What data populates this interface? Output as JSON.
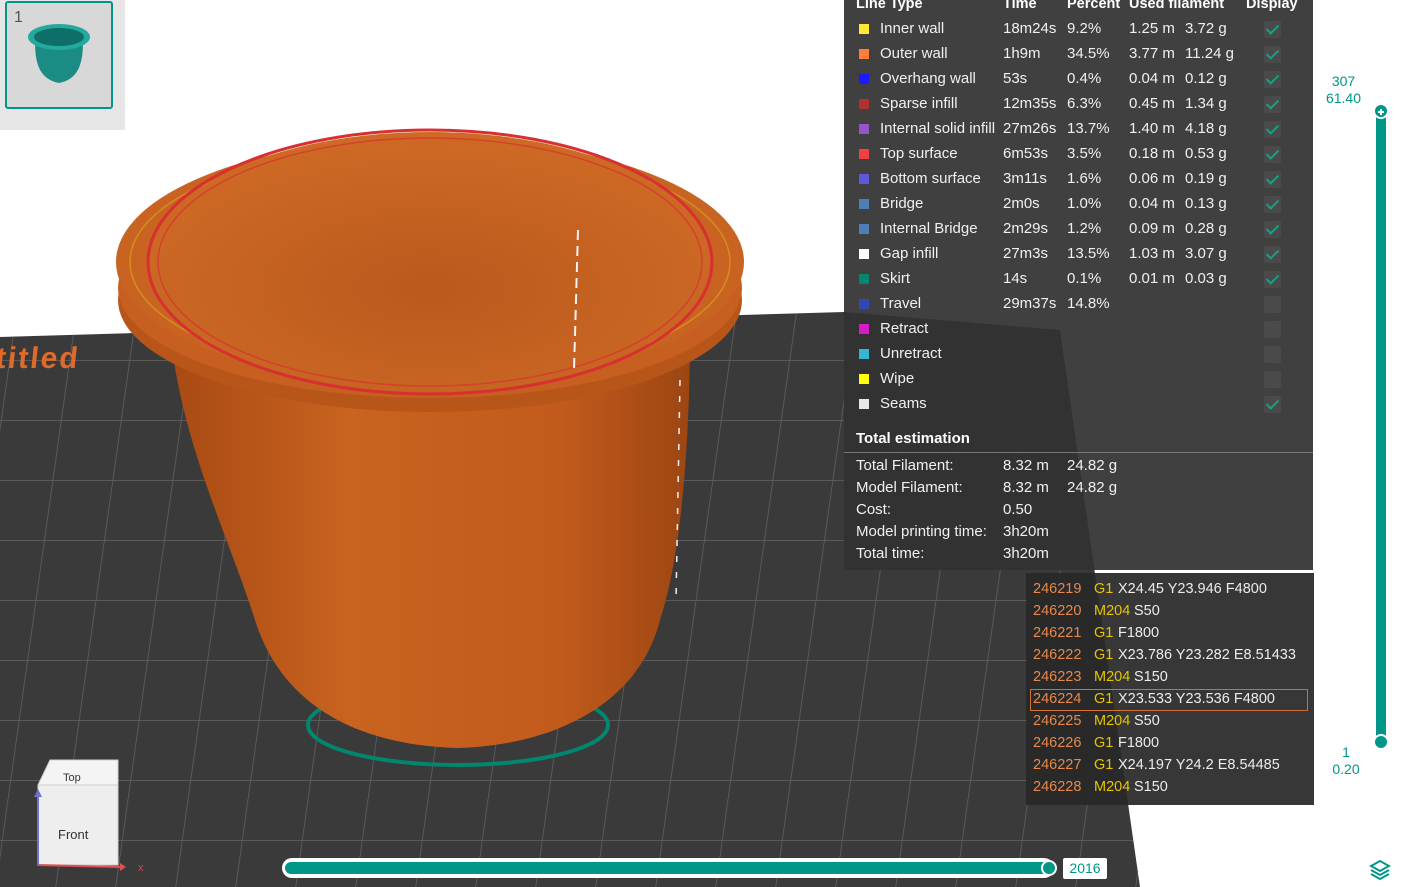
{
  "thumbnail": {
    "index": "1"
  },
  "bed": {
    "label": "titled"
  },
  "legend": {
    "headers": {
      "line_type": "Line Type",
      "time": "Time",
      "percent": "Percent",
      "used": "Used filament",
      "display": "Display"
    },
    "rows": [
      {
        "name": "Inner wall",
        "color": "#FFE733",
        "time": "18m24s",
        "percent": "9.2%",
        "length": "1.25 m",
        "weight": "3.72 g",
        "display": true
      },
      {
        "name": "Outer wall",
        "color": "#FF7D38",
        "time": "1h9m",
        "percent": "34.5%",
        "length": "3.77 m",
        "weight": "11.24 g",
        "display": true
      },
      {
        "name": "Overhang wall",
        "color": "#1A19FF",
        "time": "53s",
        "percent": "0.4%",
        "length": "0.04 m",
        "weight": "0.12 g",
        "display": true
      },
      {
        "name": "Sparse infill",
        "color": "#B0302E",
        "time": "12m35s",
        "percent": "6.3%",
        "length": "0.45 m",
        "weight": "1.34 g",
        "display": true
      },
      {
        "name": "Internal solid infill",
        "color": "#9654CC",
        "time": "27m26s",
        "percent": "13.7%",
        "length": "1.40 m",
        "weight": "4.18 g",
        "display": true
      },
      {
        "name": "Top surface",
        "color": "#F04040",
        "time": "6m53s",
        "percent": "3.5%",
        "length": "0.18 m",
        "weight": "0.53 g",
        "display": true
      },
      {
        "name": "Bottom surface",
        "color": "#5A5ADB",
        "time": "3m11s",
        "percent": "1.6%",
        "length": "0.06 m",
        "weight": "0.19 g",
        "display": true
      },
      {
        "name": "Bridge",
        "color": "#4D7FB8",
        "time": "2m0s",
        "percent": "1.0%",
        "length": "0.04 m",
        "weight": "0.13 g",
        "display": true
      },
      {
        "name": "Internal Bridge",
        "color": "#4D7FB8",
        "time": "2m29s",
        "percent": "1.2%",
        "length": "0.09 m",
        "weight": "0.28 g",
        "display": true
      },
      {
        "name": "Gap infill",
        "color": "#FFFFFF",
        "time": "27m3s",
        "percent": "13.5%",
        "length": "1.03 m",
        "weight": "3.07 g",
        "display": true
      },
      {
        "name": "Skirt",
        "color": "#00876E",
        "time": "14s",
        "percent": "0.1%",
        "length": "0.01 m",
        "weight": "0.03 g",
        "display": true
      },
      {
        "name": "Travel",
        "color": "#3048B0",
        "time": "29m37s",
        "percent": "14.8%",
        "length": "",
        "weight": "",
        "display": false
      },
      {
        "name": "Retract",
        "color": "#D51CC8",
        "time": "",
        "percent": "",
        "length": "",
        "weight": "",
        "display": false
      },
      {
        "name": "Unretract",
        "color": "#34B5D5",
        "time": "",
        "percent": "",
        "length": "",
        "weight": "",
        "display": false
      },
      {
        "name": "Wipe",
        "color": "#FFFF00",
        "time": "",
        "percent": "",
        "length": "",
        "weight": "",
        "display": false
      },
      {
        "name": "Seams",
        "color": "#E6E6E6",
        "time": "",
        "percent": "",
        "length": "",
        "weight": "",
        "display": true
      }
    ],
    "totals": {
      "title": "Total estimation",
      "rows": [
        {
          "label": "Total Filament:",
          "v1": "8.32 m",
          "v2": "24.82 g"
        },
        {
          "label": "Model Filament:",
          "v1": "8.32 m",
          "v2": "24.82 g"
        },
        {
          "label": "Cost:",
          "v1": "0.50",
          "v2": ""
        },
        {
          "label": "Model printing time:",
          "v1": "3h20m",
          "v2": ""
        },
        {
          "label": "Total time:",
          "v1": "3h20m",
          "v2": ""
        }
      ]
    }
  },
  "gcode": {
    "lines": [
      {
        "num": "246219",
        "cmd": "G1",
        "args": "X24.45 Y23.946 F4800"
      },
      {
        "num": "246220",
        "cmd": "M204",
        "args": "S50"
      },
      {
        "num": "246221",
        "cmd": "G1",
        "args": "F1800"
      },
      {
        "num": "246222",
        "cmd": "G1",
        "args": "X23.786 Y23.282 E8.51433"
      },
      {
        "num": "246223",
        "cmd": "M204",
        "args": "S150"
      },
      {
        "num": "246224",
        "cmd": "G1",
        "args": "X23.533 Y23.536 F4800",
        "selected": true
      },
      {
        "num": "246225",
        "cmd": "M204",
        "args": "S50"
      },
      {
        "num": "246226",
        "cmd": "G1",
        "args": "F1800"
      },
      {
        "num": "246227",
        "cmd": "G1",
        "args": "X24.197 Y24.2 E8.54485"
      },
      {
        "num": "246228",
        "cmd": "M204",
        "args": "S150"
      }
    ]
  },
  "layer_slider": {
    "top_layer": "307",
    "top_height": "61.40",
    "bottom_layer": "1",
    "bottom_height": "0.20"
  },
  "move_slider": {
    "value": "2016"
  },
  "navcube": {
    "top": "Top",
    "front": "Front",
    "axis_x": "x"
  },
  "colors": {
    "accent": "#009688",
    "model": "#C25A1C",
    "bed": "#3A3A3A"
  }
}
